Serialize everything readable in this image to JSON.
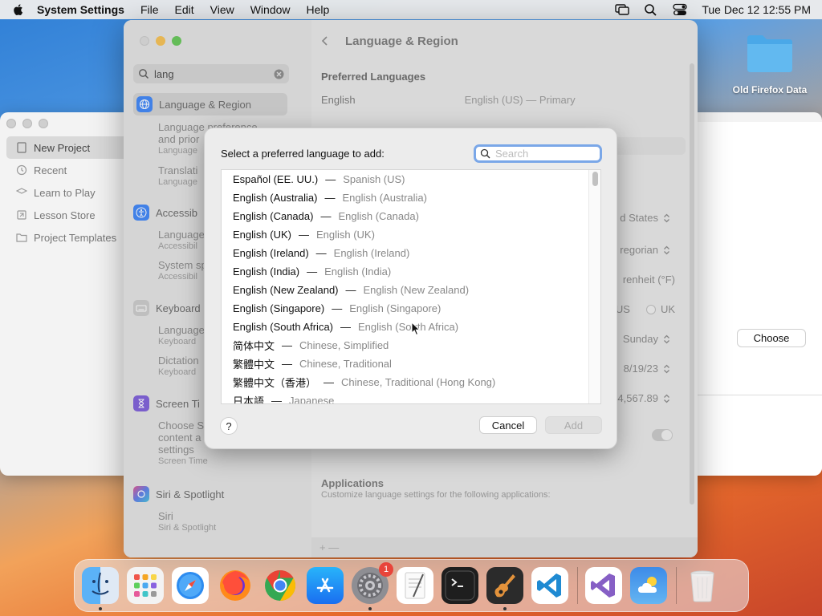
{
  "menubar": {
    "app_name": "System Settings",
    "items": [
      "File",
      "Edit",
      "View",
      "Window",
      "Help"
    ],
    "clock": "Tue Dec 12  12:55 PM"
  },
  "desktop": {
    "folder_label": "Old Firefox Data"
  },
  "bg_window": {
    "sidebar": [
      "New Project",
      "Recent",
      "Learn to Play",
      "Lesson Store",
      "Project Templates"
    ],
    "choose_label": "Choose"
  },
  "settings": {
    "search_value": "lang",
    "title": "Language & Region",
    "sidebar": {
      "language_region": "Language & Region",
      "lr_sub1a": "Language preference",
      "lr_sub1b": "and prior",
      "lr_sub1c": "Language",
      "lr_sub2a": "Translati",
      "lr_sub2b": "Language",
      "accessibility": "Accessib",
      "acc_sub1a": "Language",
      "acc_sub1b": "Accessibil",
      "acc_sub2a": "System sp",
      "acc_sub2b": "Accessibil",
      "keyboard": "Keyboard",
      "kb_sub1a": "Language",
      "kb_sub1b": "Keyboard",
      "kb_sub2a": "Dictation",
      "kb_sub2b": "Keyboard",
      "screen_time": "Screen Ti",
      "st_sub_a": "Choose S",
      "st_sub_b": "content a",
      "st_sub_c": "settings",
      "st_sub_d": "Screen Time",
      "siri": "Siri & Spotlight",
      "siri_sub_a": "Siri",
      "siri_sub_b": "Siri & Spotlight"
    },
    "content": {
      "preferred_languages": "Preferred Languages",
      "lang_name": "English",
      "lang_value": "English (US) — Primary",
      "region_value": "d States",
      "calendar_value": "regorian",
      "temp_value": "renheit (°F)",
      "measure_us": "US",
      "measure_uk": "UK",
      "first_day": "Sunday",
      "date_format": "8/19/23",
      "number_format": "4,567.89",
      "applications": "Applications",
      "applications_sub": "Customize language settings for the following applications:",
      "bottom_plus": "+   —"
    }
  },
  "sheet": {
    "prompt": "Select a preferred language to add:",
    "search_placeholder": "Search",
    "languages": [
      {
        "native": "Español (EE. UU.)",
        "english": "Spanish (US)"
      },
      {
        "native": "English (Australia)",
        "english": "English (Australia)"
      },
      {
        "native": "English (Canada)",
        "english": "English (Canada)"
      },
      {
        "native": "English (UK)",
        "english": "English (UK)"
      },
      {
        "native": "English (Ireland)",
        "english": "English (Ireland)"
      },
      {
        "native": "English (India)",
        "english": "English (India)"
      },
      {
        "native": "English (New Zealand)",
        "english": "English (New Zealand)"
      },
      {
        "native": "English (Singapore)",
        "english": "English (Singapore)"
      },
      {
        "native": "English (South Africa)",
        "english": "English (South Africa)"
      },
      {
        "native": "简体中文",
        "english": "Chinese, Simplified"
      },
      {
        "native": "繁體中文",
        "english": "Chinese, Traditional"
      },
      {
        "native": "繁體中文（香港）",
        "english": "Chinese, Traditional (Hong Kong)"
      },
      {
        "native": "日本語",
        "english": "Japanese"
      }
    ],
    "dash": "—",
    "help_label": "?",
    "cancel_label": "Cancel",
    "add_label": "Add"
  },
  "dock": {
    "apps": [
      "finder-icon",
      "launchpad-icon",
      "safari-icon",
      "firefox-icon",
      "chrome-icon",
      "app-store-icon",
      "system-settings-icon",
      "textedit-icon",
      "terminal-icon",
      "garageband-icon",
      "vscode-icon",
      "visual-studio-icon",
      "weather-icon",
      "trash-icon"
    ],
    "settings_badge": "1"
  },
  "colors": {
    "accent": "#3478f6",
    "search_focus": "#7aa7e8"
  }
}
